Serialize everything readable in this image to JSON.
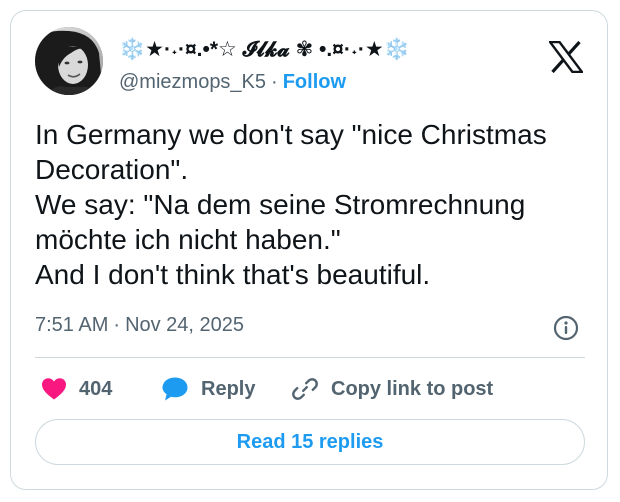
{
  "author": {
    "display_name": "❄️★·˖·¤.•*☆ 𝓘𝓵𝓴𝓪 ✾ •.¤·˖·★❄️",
    "handle": "@miezmops_K5",
    "separator": "·",
    "follow_label": "Follow",
    "avatar_icon": "avatar-photo"
  },
  "brand": {
    "logo_icon": "x-logo-icon"
  },
  "tweet": {
    "lines": [
      "In Germany we don't say \"nice Christmas",
      "Decoration\".",
      "We say: \"Na dem seine Stromrechnung",
      "möchte ich nicht haben.\"",
      "And I don't think that's beautiful."
    ],
    "time": "7:51 AM",
    "separator": "·",
    "date": "Nov 24, 2025",
    "info_icon": "info-icon"
  },
  "actions": {
    "like_count": "404",
    "reply_label": "Reply",
    "copy_label": "Copy link to post",
    "read_replies_label": "Read 15 replies"
  },
  "colors": {
    "accent": "#1d9bf0",
    "like": "#f91880",
    "secondary_text": "#536471",
    "border": "#cfd9de"
  }
}
